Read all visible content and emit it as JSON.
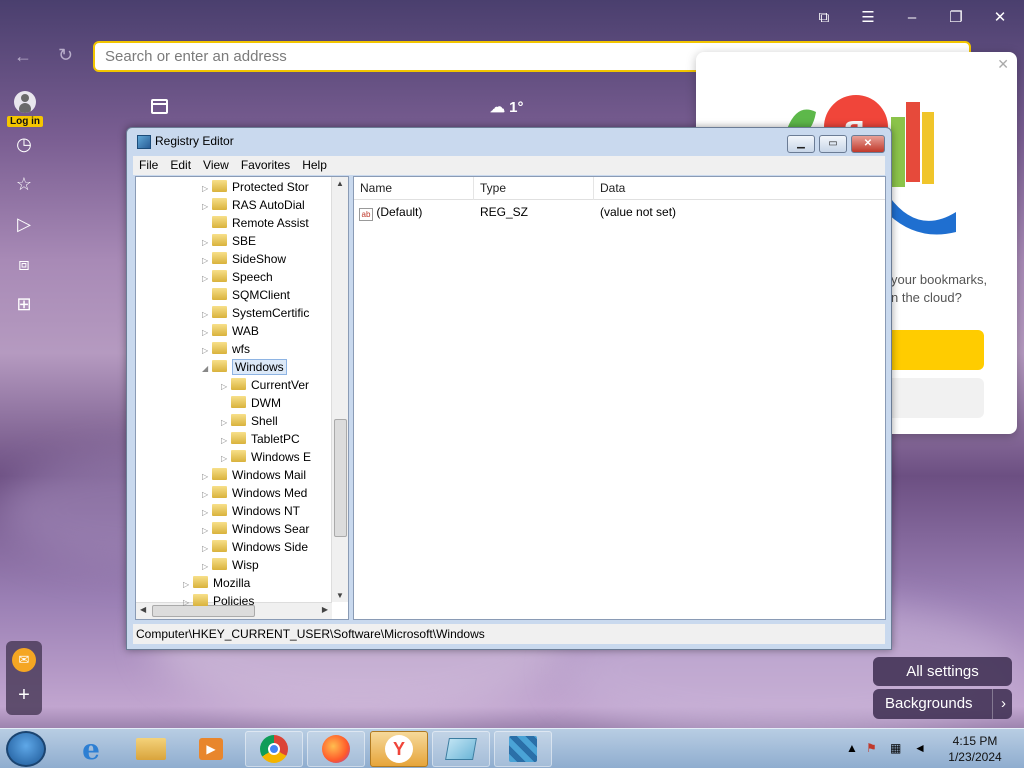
{
  "browser": {
    "address_placeholder": "Search or enter an address",
    "login_label": "Log in",
    "weather": "1°"
  },
  "popup": {
    "text_line1": "your bookmarks,",
    "text_line2": "n the cloud?"
  },
  "regedit": {
    "title": "Registry Editor",
    "menu": [
      "File",
      "Edit",
      "View",
      "Favorites",
      "Help"
    ],
    "tree": [
      {
        "label": "Protected Stor",
        "expander": "▷",
        "level": 1
      },
      {
        "label": "RAS AutoDial",
        "expander": "▷",
        "level": 1
      },
      {
        "label": "Remote Assist",
        "expander": "",
        "level": 1
      },
      {
        "label": "SBE",
        "expander": "▷",
        "level": 1
      },
      {
        "label": "SideShow",
        "expander": "▷",
        "level": 1
      },
      {
        "label": "Speech",
        "expander": "▷",
        "level": 1
      },
      {
        "label": "SQMClient",
        "expander": "",
        "level": 1
      },
      {
        "label": "SystemCertific",
        "expander": "▷",
        "level": 1
      },
      {
        "label": "WAB",
        "expander": "▷",
        "level": 1
      },
      {
        "label": "wfs",
        "expander": "▷",
        "level": 1
      },
      {
        "label": "Windows",
        "expander": "◢",
        "level": 1,
        "selected": true
      },
      {
        "label": "CurrentVer",
        "expander": "▷",
        "level": 2
      },
      {
        "label": "DWM",
        "expander": "",
        "level": 2
      },
      {
        "label": "Shell",
        "expander": "▷",
        "level": 2
      },
      {
        "label": "TabletPC",
        "expander": "▷",
        "level": 2
      },
      {
        "label": "Windows E",
        "expander": "▷",
        "level": 2
      },
      {
        "label": "Windows Mail",
        "expander": "▷",
        "level": 1
      },
      {
        "label": "Windows Med",
        "expander": "▷",
        "level": 1
      },
      {
        "label": "Windows NT",
        "expander": "▷",
        "level": 1
      },
      {
        "label": "Windows Sear",
        "expander": "▷",
        "level": 1
      },
      {
        "label": "Windows Side",
        "expander": "▷",
        "level": 1
      },
      {
        "label": "Wisp",
        "expander": "▷",
        "level": 1
      },
      {
        "label": "Mozilla",
        "expander": "▷",
        "level": 0
      },
      {
        "label": "Policies",
        "expander": "▷",
        "level": 0
      }
    ],
    "columns": {
      "name": "Name",
      "type": "Type",
      "data": "Data"
    },
    "values": [
      {
        "name": "(Default)",
        "type": "REG_SZ",
        "data": "(value not set)"
      }
    ],
    "status": "Computer\\HKEY_CURRENT_USER\\Software\\Microsoft\\Windows"
  },
  "settings": {
    "all_settings": "All settings",
    "backgrounds": "Backgrounds"
  },
  "taskbar": {
    "time": "4:15 PM",
    "date": "1/23/2024"
  }
}
